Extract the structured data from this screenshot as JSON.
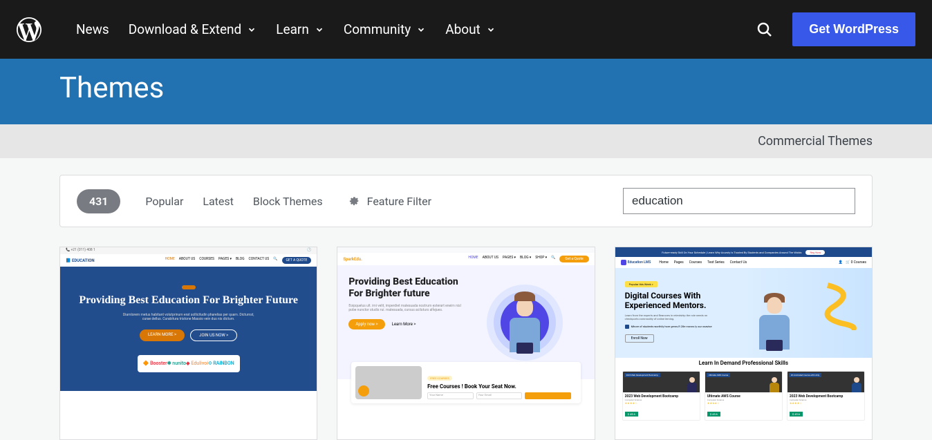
{
  "header": {
    "nav": {
      "news": "News",
      "download": "Download & Extend",
      "learn": "Learn",
      "community": "Community",
      "about": "About"
    },
    "get_wp": "Get WordPress"
  },
  "title_bar": {
    "title": "Themes"
  },
  "commercial_bar": {
    "link": "Commercial Themes"
  },
  "filter": {
    "count": "431",
    "tabs": {
      "popular": "Popular",
      "latest": "Latest",
      "block": "Block Themes"
    },
    "feature_filter": "Feature Filter",
    "search_value": "education"
  },
  "themes": {
    "t1": {
      "logo": "📘 EDUCATION",
      "nav_home": "HOME",
      "nav_about": "ABOUT US",
      "nav_courses": "COURSES",
      "nav_pages": "PAGES ▾",
      "nav_blog": "BLOG",
      "nav_contact": "CONTACT US",
      "cta": "GET A QUOTE",
      "hero_title": "Providing Best Education For Brighter Future",
      "hero_sub": "Diamlorem metus habitant volutprinum erat sollicitudin pharelias per quam. Dictumst, curae dellus. Curabitura tristone Massio vein dus nis dictum.",
      "btn1": "LEARN MORE >",
      "btn2": "JOIN US NOW >",
      "logo_b": "🔶 Booster",
      "logo_n": "✽ nunito",
      "logo_e": "Edulivoi",
      "logo_r": "⟐ RAINBON"
    },
    "t2": {
      "logo_main": "Spark",
      "logo_accent": "Edu.",
      "nav_home": "HOME",
      "nav_about": "ABOUT US",
      "nav_pages": "PAGES ▾",
      "nav_blog": "BLOG ▾",
      "nav_shop": "SHOP ▾",
      "cta": "Get a Quote",
      "hero_title": "Providing Best Education For Brighter future",
      "hero_sub": "Eoipquelus ult. imi velit, imperdiet malesuada nostrum esterart eneim nisl pobe nunctor studis rui. malesuada, cursus aciluturs alfejues.",
      "btn1": "Apply now >",
      "btn2": "Learn More >",
      "bottom_badge": "FREE COURSES",
      "bottom_title": "Free Courses ! Book Your Seat Now.",
      "input1": "Your Name",
      "input2": "Your Email"
    },
    "t3": {
      "promo": "Future-ready Skill On Your Schedule | Learn Why Acursty Is Trusted By Students and Companies Around The Wolds",
      "promo_btn": "Reg Now",
      "logo": "Education LMS",
      "nav_home": "Home",
      "nav_pages": "Pages",
      "nav_courses": "Courses",
      "nav_test": "Test Series",
      "nav_contact": "Contact Us",
      "nav_right": "🛒 0 Courses",
      "hero_badge": "Popular this Week >",
      "hero_title": "Digital Courses With Experienced Mentors.",
      "hero_sub": "Learn from the experts and flearoves in relentship the role needs nn checkports commodity of online lerning.",
      "hero_check": "Mhore of students worthily hore gems.R 28e movns ly our osavise",
      "hero_btn": "Enroll Now",
      "section": "Learn In Demand Professional Skills",
      "c1_badge": "2023 Web Development Bootcamp",
      "c1_title": "2023 Web Development Bootcamp",
      "c1_sub": "Computer Science",
      "c1_price": "$ 45.6",
      "c2_badge": "Ultimate AWS Course",
      "c2_title": "Ultimate AWS Course",
      "c2_sub": "Computer Science",
      "c2_price": "$ 45.6",
      "c3_badge": "2D Animated Course with Unity",
      "c3_title": "2023 Web Development Bootcamp",
      "c3_sub": "Computer Science",
      "c3_price": "$ 45.6"
    }
  }
}
